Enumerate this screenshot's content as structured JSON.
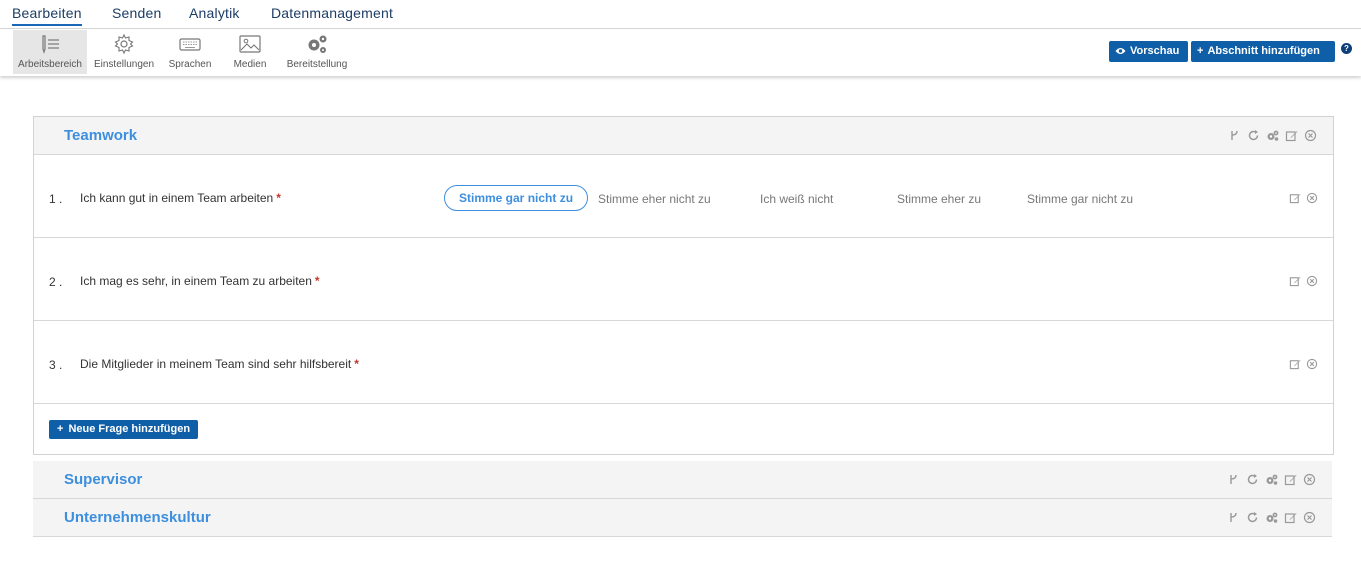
{
  "nav": {
    "tabs": [
      {
        "label": "Bearbeiten",
        "active": true
      },
      {
        "label": "Senden"
      },
      {
        "label": "Analytik"
      },
      {
        "label": "Datenmanagement"
      }
    ]
  },
  "toolbar": {
    "tools": [
      {
        "label": "Arbeitsbereich",
        "icon": "workspace-icon",
        "active": true
      },
      {
        "label": "Einstellungen",
        "icon": "gear-icon"
      },
      {
        "label": "Sprachen",
        "icon": "keyboard-icon"
      },
      {
        "label": "Medien",
        "icon": "image-icon"
      },
      {
        "label": "Bereitstellung",
        "icon": "gears-icon"
      }
    ],
    "preview_label": "Vorschau",
    "add_section_label": "Abschnitt hinzufügen",
    "help_glyph": "?"
  },
  "sections": [
    {
      "title": "Teamwork",
      "expanded": true,
      "questions": [
        {
          "number": "1 .",
          "text": "Ich kann gut in einem Team arbeiten",
          "required": "*"
        },
        {
          "number": "2 .",
          "text": "Ich mag es sehr, in einem Team zu arbeiten",
          "required": "*"
        },
        {
          "number": "3 .",
          "text": "Die Mitglieder in meinem Team sind sehr hilfsbereit",
          "required": "*"
        }
      ],
      "answer_options": [
        "Stimme gar nicht zu",
        "Stimme eher nicht zu",
        "Ich weiß nicht",
        "Stimme eher zu",
        "Stimme gar nicht zu"
      ],
      "selected_option": "Stimme gar nicht zu",
      "add_question_label": "Neue Frage hinzufügen"
    },
    {
      "title": "Supervisor",
      "expanded": false
    },
    {
      "title": "Unternehmenskultur",
      "expanded": false
    }
  ],
  "colors": {
    "accent": "#3d8fde",
    "primary_button": "#0f5fa8",
    "nav_text": "#1d3d66",
    "required": "#c0392b"
  }
}
